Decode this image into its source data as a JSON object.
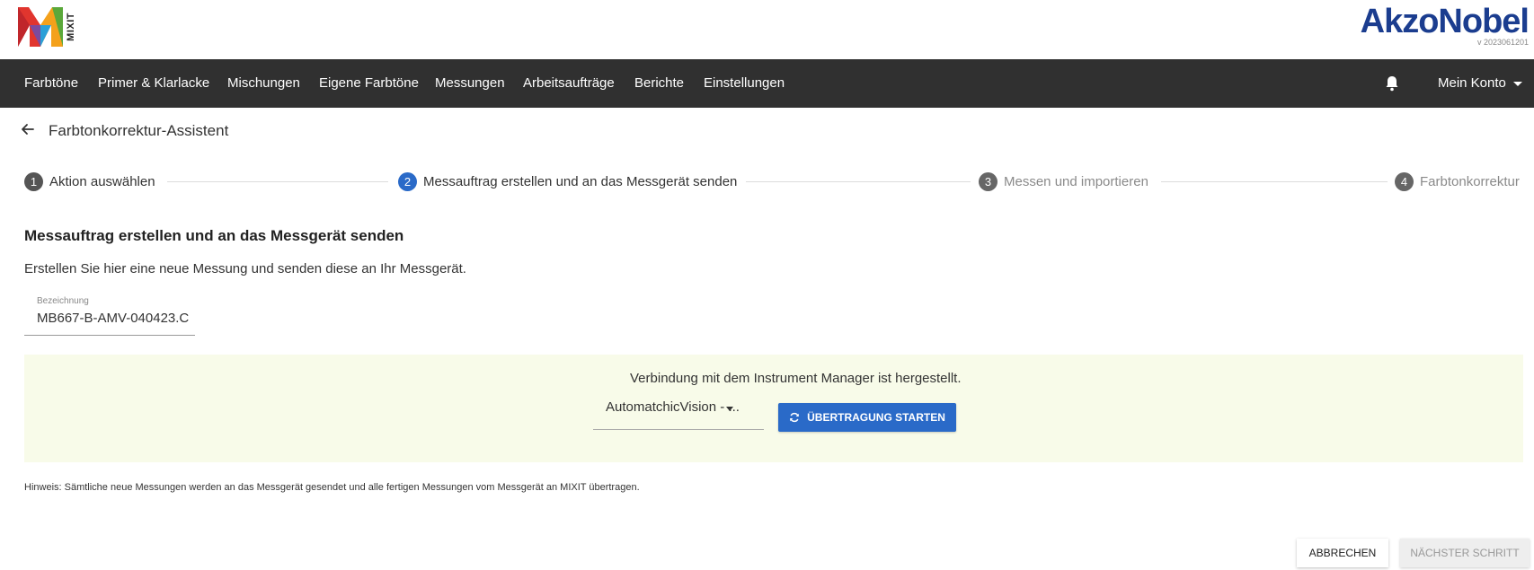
{
  "header": {
    "logo_text": "MIXIT",
    "brand": "AkzoNobel",
    "version": "v 2023061201"
  },
  "nav": {
    "items": [
      {
        "label": "Farbtöne"
      },
      {
        "label": "Primer & Klarlacke"
      },
      {
        "label": "Mischungen"
      },
      {
        "label": "Eigene Farbtöne"
      },
      {
        "label": "Messungen"
      },
      {
        "label": "Arbeitsaufträge"
      },
      {
        "label": "Berichte"
      },
      {
        "label": "Einstellungen"
      }
    ],
    "bell_icon": "bell-icon",
    "account_label": "Mein Konto"
  },
  "page": {
    "title": "Farbtonkorrektur-Assistent"
  },
  "stepper": {
    "steps": [
      {
        "number": "1",
        "label": "Aktion auswählen",
        "state": "done"
      },
      {
        "number": "2",
        "label": "Messauftrag erstellen und an das Messgerät senden",
        "state": "active"
      },
      {
        "number": "3",
        "label": "Messen und importieren",
        "state": "todo"
      },
      {
        "number": "4",
        "label": "Farbtonkorrektur",
        "state": "todo"
      }
    ]
  },
  "section": {
    "heading": "Messauftrag erstellen und an das Messgerät senden",
    "description": "Erstellen Sie hier eine neue Messung und senden diese an Ihr Messgerät."
  },
  "designation": {
    "label": "Bezeichnung",
    "value": "MB667-B-AMV-040423.C"
  },
  "instrument": {
    "status_text": "Verbindung mit dem Instrument Manager ist hergestellt.",
    "device_selected": "AutomatchicVision - ...",
    "start_button": "ÜBERTRAGUNG STARTEN"
  },
  "hint": "Hinweis: Sämtliche neue Messungen werden an das Messgerät gesendet und alle fertigen Messungen vom Messgerät an MIXIT übertragen.",
  "footer": {
    "cancel": "ABBRECHEN",
    "next": "NÄCHSTER SCHRITT"
  },
  "colors": {
    "navbar": "#303030",
    "accent": "#2a6ac8",
    "brand": "#1b3d8f",
    "info_bg": "#f8fbe9"
  }
}
